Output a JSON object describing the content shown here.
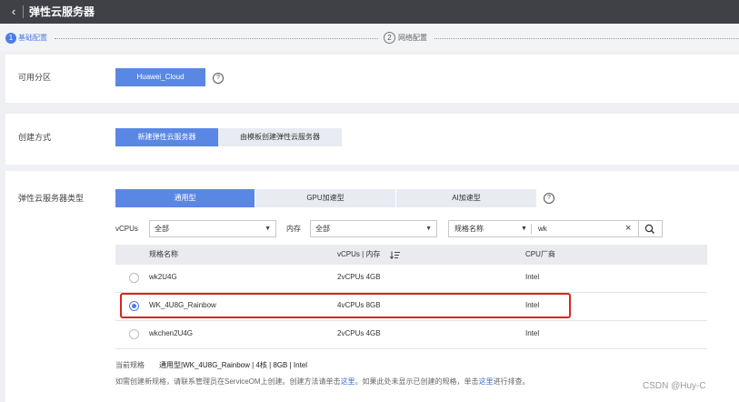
{
  "header": {
    "back_icon": "chevron-left-icon",
    "title": "弹性云服务器"
  },
  "steps": [
    {
      "number": "1",
      "label": "基础配置",
      "active": true
    },
    {
      "number": "2",
      "label": "网络配置",
      "active": false
    }
  ],
  "availability_zone": {
    "label": "可用分区",
    "value": "Huawei_Cloud",
    "help_icon": "question-circle-icon"
  },
  "create_method": {
    "label": "创建方式",
    "options": [
      "新建弹性云服务器",
      "由模板创建弹性云服务器"
    ],
    "selected": "新建弹性云服务器"
  },
  "server_type": {
    "label": "弹性云服务器类型",
    "tabs": [
      "通用型",
      "GPU加速型",
      "AI加速型"
    ],
    "selected": "通用型",
    "help_icon": "question-circle-icon"
  },
  "filters": {
    "vcpus_label": "vCPUs",
    "vcpus_value": "全部",
    "memory_label": "内存",
    "memory_value": "全部",
    "search_field": "规格名称",
    "search_value": "wk",
    "clear_icon": "close-icon",
    "search_icon": "search-icon"
  },
  "table": {
    "columns": [
      "规格名称",
      "vCPUs | 内存",
      "CPU厂商"
    ],
    "sort_icon": "sort-icon",
    "rows": [
      {
        "name": "wk2U4G",
        "spec": "2vCPUs 4GB",
        "vendor": "Intel",
        "selected": false
      },
      {
        "name": "WK_4U8G_Rainbow",
        "spec": "4vCPUs 8GB",
        "vendor": "Intel",
        "selected": true
      },
      {
        "name": "wkchen2U4G",
        "spec": "2vCPUs 4GB",
        "vendor": "Intel",
        "selected": false
      }
    ]
  },
  "current_spec": {
    "label": "当前规格",
    "value": "通用型|WK_4U8G_Rainbow | 4核 | 8GB | Intel"
  },
  "note": {
    "part1": "如需创建新规格，请联系管理员在ServiceOM上创建。创建方法请单击",
    "link1": "这里",
    "part2": "。如果此处未显示已创建的规格，单击",
    "link2": "这里",
    "part3": "进行排查。"
  },
  "watermark": "CSDN @Huy-C",
  "colors": {
    "primary": "#5a87e3",
    "highlight": "#d9261c",
    "topbar": "#3f4147"
  }
}
